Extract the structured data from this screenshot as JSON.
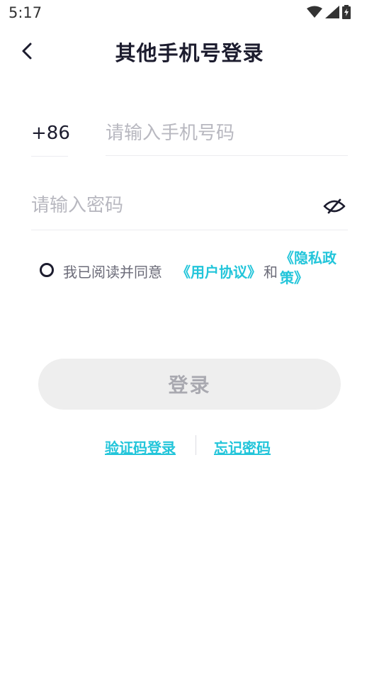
{
  "status_bar": {
    "time": "5:17",
    "icons": [
      "wifi-icon",
      "signal-icon",
      "battery-icon"
    ]
  },
  "header": {
    "title": "其他手机号登录",
    "back_icon": "chevron-left-icon"
  },
  "phone": {
    "country_code": "+86",
    "placeholder": "请输入手机号码",
    "value": ""
  },
  "password": {
    "placeholder": "请输入密码",
    "value": "",
    "toggle_icon": "eye-off-icon"
  },
  "agreement": {
    "checked": false,
    "prefix": "我已阅读并同意",
    "user_agreement": "《用户协议》",
    "and": "和",
    "privacy_policy": "《隐私政策》"
  },
  "login_button": {
    "label": "登录",
    "enabled": false
  },
  "links": {
    "sms_login": "验证码登录",
    "forgot_password": "忘记密码"
  },
  "colors": {
    "accent": "#22c5da",
    "title_text": "#1c1c2e",
    "placeholder": "#b8b8c0",
    "button_disabled_bg": "#eeeeee",
    "button_disabled_text": "#a9a9b0"
  }
}
